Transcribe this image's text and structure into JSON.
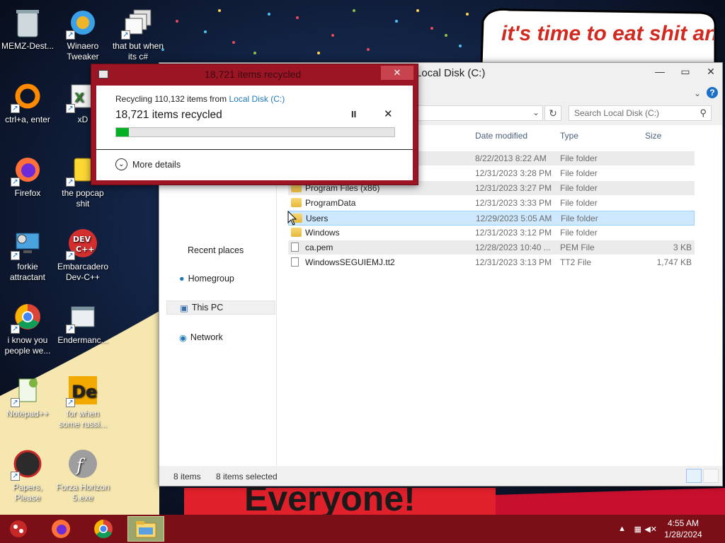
{
  "wallpaper": {
    "banner_text": "it's time to eat shit and die andcelebrate",
    "bottom_text": "Everyone!"
  },
  "desktop_icons": [
    {
      "label": "MEMZ-Dest...",
      "icon": "recycle-bin-icon"
    },
    {
      "label": "Winaero Tweaker",
      "icon": "winaero-icon"
    },
    {
      "label": "that but when its c#",
      "icon": "stacked-windows-icon"
    },
    {
      "label": "ctrl+a, enter",
      "icon": "orange-ring-icon"
    },
    {
      "label": "xD",
      "icon": "hx-icon"
    },
    {
      "label": "Firefox",
      "icon": "firefox-icon"
    },
    {
      "label": "the popcap shit",
      "icon": "popcap-icon"
    },
    {
      "label": "forkie attractant",
      "icon": "computer-gear-icon"
    },
    {
      "label": "Embarcadero Dev-C++",
      "icon": "devcpp-icon"
    },
    {
      "label": "i know you people we...",
      "icon": "chrome-icon"
    },
    {
      "label": "Endermanc...",
      "icon": "window-app-icon"
    },
    {
      "label": "Notepad++",
      "icon": "notepadpp-icon"
    },
    {
      "label": "for when some russi...",
      "icon": "de-icon"
    },
    {
      "label": "Papers, Please",
      "icon": "papers-please-icon"
    },
    {
      "label": "Forza Horizon 5.exe",
      "icon": "flash-icon"
    }
  ],
  "explorer": {
    "title": "Local Disk (C:)",
    "search_placeholder": "Search Local Disk (C:)",
    "nav": [
      {
        "label": "Recent places",
        "icon": "recent-places-icon"
      },
      {
        "label": "Homegroup",
        "icon": "homegroup-icon"
      },
      {
        "label": "This PC",
        "icon": "this-pc-icon"
      },
      {
        "label": "Network",
        "icon": "network-icon"
      }
    ],
    "columns": {
      "date": "Date modified",
      "type": "Type",
      "size": "Size"
    },
    "rows": [
      {
        "name": "",
        "date": "8/22/2013 8:22 AM",
        "type": "File folder",
        "size": "",
        "kind": "folder"
      },
      {
        "name": "",
        "date": "12/31/2023 3:28 PM",
        "type": "File folder",
        "size": "",
        "kind": "folder"
      },
      {
        "name": "Program Files (x86)",
        "date": "12/31/2023 3:27 PM",
        "type": "File folder",
        "size": "",
        "kind": "folder"
      },
      {
        "name": "ProgramData",
        "date": "12/31/2023 3:33 PM",
        "type": "File folder",
        "size": "",
        "kind": "folder"
      },
      {
        "name": "Users",
        "date": "12/29/2023 5:05 AM",
        "type": "File folder",
        "size": "",
        "kind": "folder"
      },
      {
        "name": "Windows",
        "date": "12/31/2023 3:12 PM",
        "type": "File folder",
        "size": "",
        "kind": "folder"
      },
      {
        "name": "ca.pem",
        "date": "12/28/2023 10:40 ...",
        "type": "PEM File",
        "size": "3 KB",
        "kind": "file"
      },
      {
        "name": "WindowsSEGUIEMJ.tt2",
        "date": "12/31/2023 3:13 PM",
        "type": "TT2 File",
        "size": "1,747 KB",
        "kind": "file"
      }
    ],
    "status_count": "8 items",
    "status_selected": "8 items selected"
  },
  "dialog": {
    "title": "18,721 items recycled",
    "line1_prefix": "Recycling 110,132 items from ",
    "line1_source": "Local Disk (C:)",
    "line2": "18,721 items recycled",
    "progress_fraction": 0.045,
    "more_details": "More details",
    "close_glyph": "✕",
    "pause_glyph": "II",
    "cancel_glyph": "✕"
  },
  "taskbar": {
    "time": "4:55 AM",
    "date": "1/28/2024",
    "pinned": [
      "start-orb-icon",
      "firefox-icon",
      "chrome-icon",
      "file-explorer-icon"
    ]
  },
  "colors": {
    "accent": "#9b1525",
    "taskbar": "#7b0f17",
    "progress": "#06b025",
    "selection": "#cde8ff"
  }
}
